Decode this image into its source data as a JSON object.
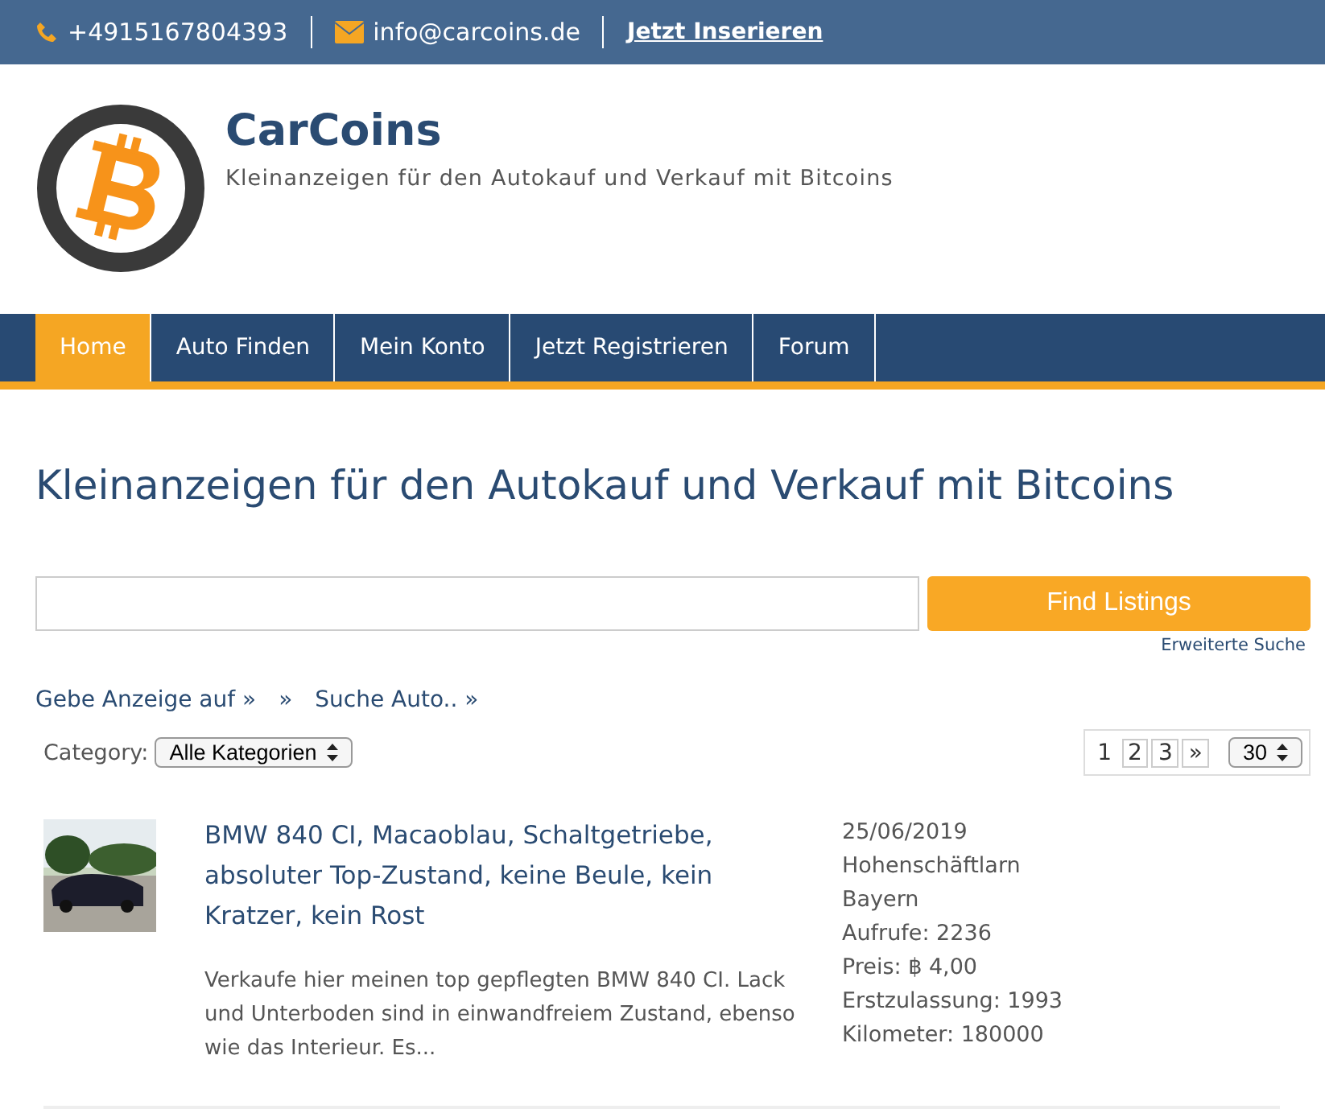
{
  "top_bar": {
    "phone": "+4915167804393",
    "email": "info@carcoins.de",
    "cta": "Jetzt Inserieren"
  },
  "header": {
    "site_title": "CarCoins",
    "tagline": "Kleinanzeigen für den Autokauf und Verkauf mit Bitcoins"
  },
  "nav": [
    {
      "label": "Home",
      "selected": true
    },
    {
      "label": "Auto Finden",
      "selected": false
    },
    {
      "label": "Mein Konto",
      "selected": false
    },
    {
      "label": "Jetzt Registrieren",
      "selected": false
    },
    {
      "label": "Forum",
      "selected": false
    }
  ],
  "page_title": "Kleinanzeigen für den Autokauf und Verkauf mit Bitcoins",
  "search": {
    "button": "Find Listings",
    "advanced": "Erweiterte Suche"
  },
  "links": [
    {
      "label": "Gebe Anzeige auf",
      "arrow": "»"
    },
    {
      "arrow": "»"
    },
    {
      "label": "Suche Auto..",
      "arrow": "»"
    }
  ],
  "filter": {
    "label": "Category:",
    "value": "Alle Kategorien"
  },
  "pagination": {
    "pages": [
      {
        "label": "1",
        "selected": true
      },
      {
        "label": "2",
        "selected": false
      },
      {
        "label": "3",
        "selected": false
      },
      {
        "label": "»",
        "selected": false
      }
    ],
    "per_page": "30"
  },
  "listings": [
    {
      "title": "BMW 840 CI, Macaoblau, Schaltgetriebe, absoluter Top-Zustand, keine Beule, kein Kratzer, kein Rost",
      "excerpt": "Verkaufe hier meinen top gepflegten BMW 840 CI. Lack und Unterboden sind in einwandfreiem Zustand, ebenso wie das Interieur. Es...",
      "details": [
        "25/06/2019",
        "Hohenschäftlarn",
        "Bayern",
        "Aufrufe: 2236",
        "Preis: ฿ 4,00",
        "Erstzulassung: 1993",
        "Kilometer: 180000"
      ]
    }
  ]
}
